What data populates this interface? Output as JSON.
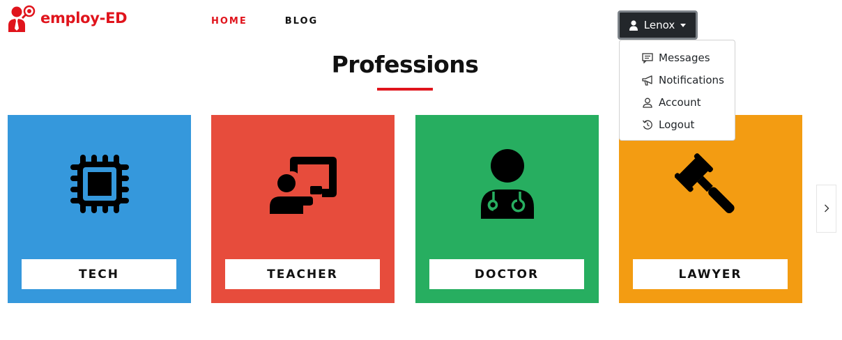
{
  "brand": {
    "name": "employ-ED",
    "color": "#e0141c"
  },
  "nav": {
    "home": "HOME",
    "blog": "BLOG"
  },
  "user": {
    "name": "Lenox",
    "menu": [
      {
        "label": "Messages",
        "icon": "message-icon"
      },
      {
        "label": "Notifications",
        "icon": "megaphone-icon"
      },
      {
        "label": "Account",
        "icon": "person-icon"
      },
      {
        "label": "Logout",
        "icon": "logout-icon"
      }
    ]
  },
  "section": {
    "title": "Professions"
  },
  "cards": [
    {
      "label": "TECH",
      "color": "#3598dc",
      "icon": "chip-icon"
    },
    {
      "label": "TEACHER",
      "color": "#e74c3c",
      "icon": "teacher-board-icon"
    },
    {
      "label": "DOCTOR",
      "color": "#27ae60",
      "icon": "doctor-icon"
    },
    {
      "label": "LAWYER",
      "color": "#f39c12",
      "icon": "gavel-icon"
    }
  ],
  "carousel": {
    "next_icon": "chevron-right-icon"
  }
}
